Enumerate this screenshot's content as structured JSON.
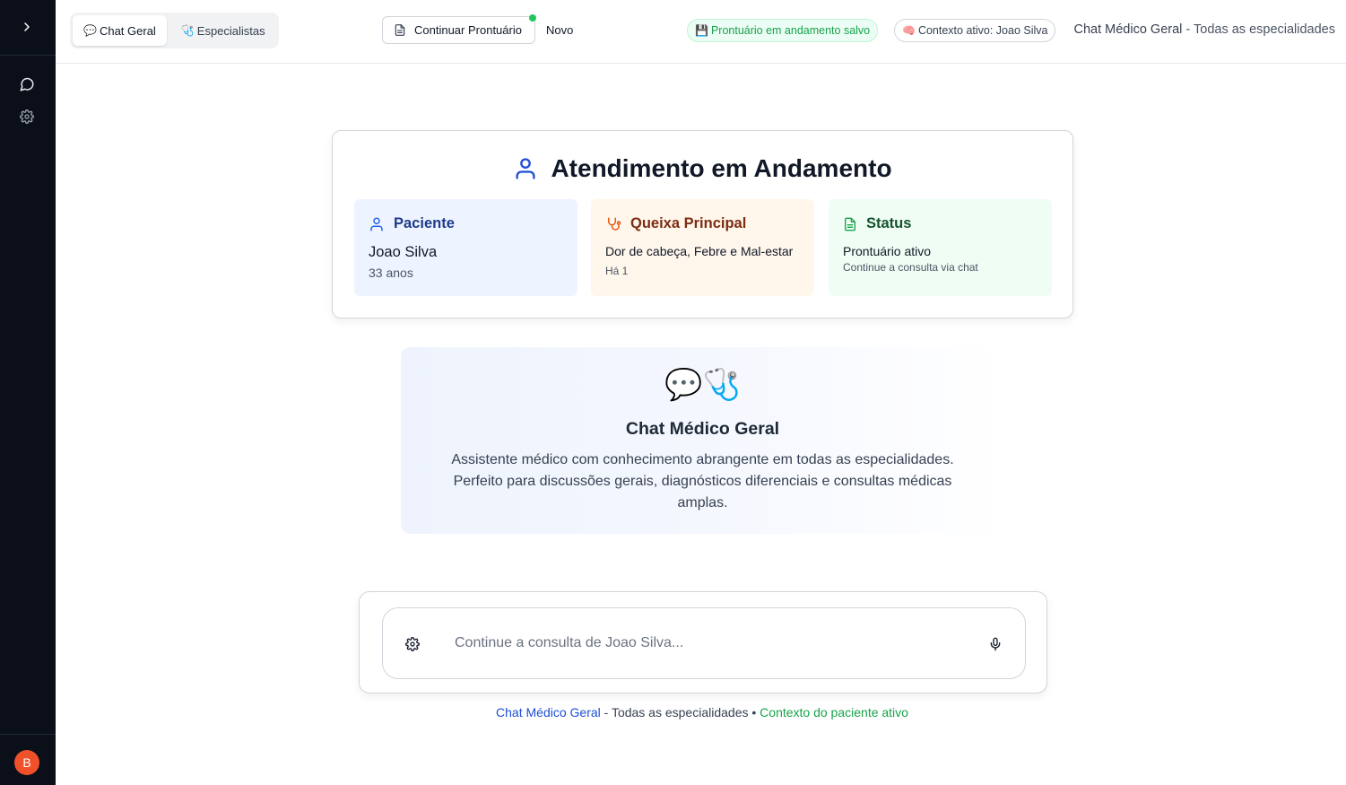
{
  "sidebar": {
    "expand_icon": "chevron-right-icon",
    "items": [
      {
        "name": "chat",
        "icon": "message-circle-icon"
      },
      {
        "name": "settings",
        "icon": "gear-icon"
      }
    ],
    "avatar_initial": "B"
  },
  "header": {
    "tabs": [
      {
        "label": "Chat Geral",
        "emoji": "💬",
        "active": true
      },
      {
        "label": "Especialistas",
        "emoji": "🩺",
        "active": false
      }
    ],
    "continue_label": "Continuar Prontuário",
    "new_label": "Novo",
    "saved_emoji": "💾",
    "saved_label": "Prontuário em andamento salvo",
    "context_emoji": "🧠",
    "context_label": "Contexto ativo: Joao Silva",
    "title_strong": "Chat Médico Geral",
    "title_separator": " - ",
    "title_muted": "Todas as especialidades"
  },
  "attendance": {
    "title": "Atendimento em Andamento",
    "patient": {
      "heading": "Paciente",
      "name": "Joao Silva",
      "age": "33 anos"
    },
    "complaint": {
      "heading": "Queixa Principal",
      "text": "Dor de cabeça, Febre e Mal-estar",
      "since": "Há 1"
    },
    "status": {
      "heading": "Status",
      "text": "Prontuário ativo",
      "hint": "Continue a consulta via chat"
    }
  },
  "intro": {
    "emoji": "💬🩺",
    "title": "Chat Médico Geral",
    "description": "Assistente médico com conhecimento abrangente em todas as especialidades. Perfeito para discussões gerais, diagnósticos diferenciais e consultas médicas amplas."
  },
  "composer": {
    "placeholder": "Continue a consulta de Joao Silva...",
    "value": ""
  },
  "footer": {
    "strong": "Chat Médico Geral",
    "middle": " - Todas as especialidades • ",
    "active": "Contexto do paciente ativo"
  },
  "colors": {
    "sidebar_bg": "#0b0f1a",
    "accent_blue": "#1d4ed8",
    "accent_green": "#16a34a",
    "accent_orange": "#ea580c",
    "avatar": "#f0512a"
  }
}
